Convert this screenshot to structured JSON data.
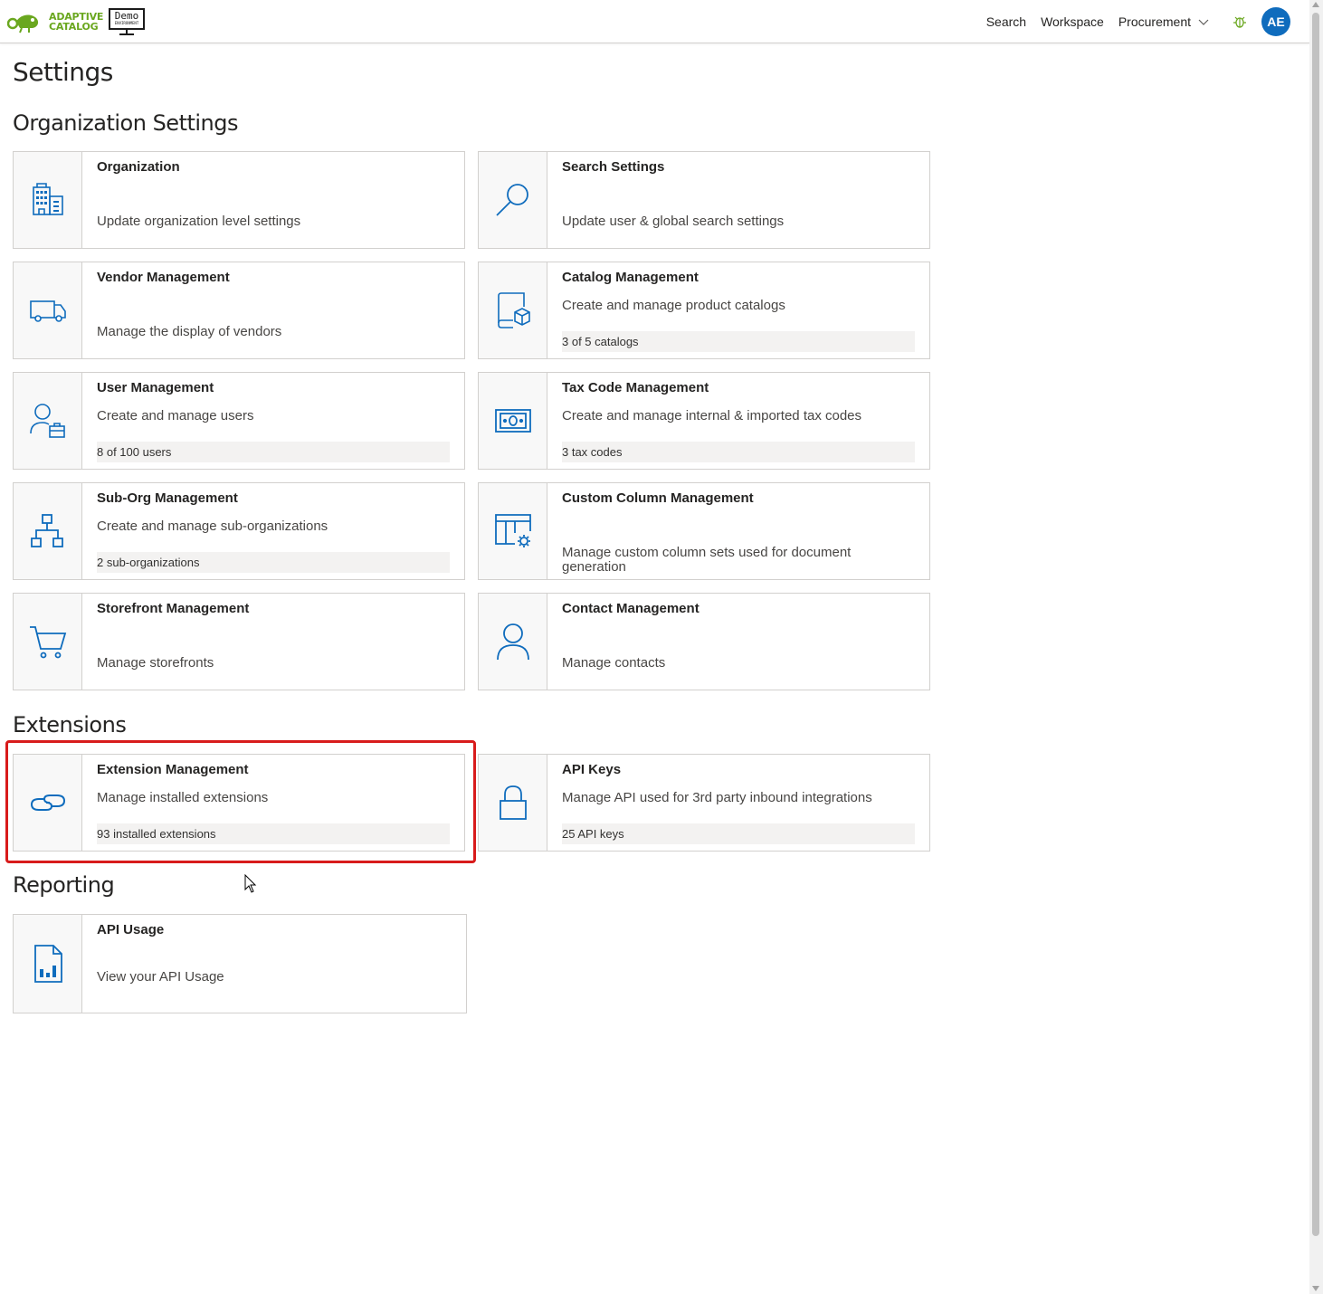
{
  "header": {
    "logo_line1": "ADAPTIVE",
    "logo_line2": "CATALOG",
    "demo_label": "Demo",
    "demo_sublabel": "ENVIRONMENT",
    "nav": {
      "search": "Search",
      "workspace": "Workspace",
      "procurement": "Procurement"
    },
    "avatar_initials": "AE",
    "accent_color": "#0f6cbd",
    "brand_color": "#6aa71f"
  },
  "page": {
    "title": "Settings"
  },
  "sections": {
    "org": "Organization Settings",
    "extensions": "Extensions",
    "reporting": "Reporting"
  },
  "cards": {
    "organization": {
      "title": "Organization",
      "desc": "Update organization level settings",
      "icon": "building-icon"
    },
    "search_settings": {
      "title": "Search Settings",
      "desc": "Update user & global search settings",
      "icon": "search-icon"
    },
    "vendor": {
      "title": "Vendor Management",
      "desc": "Manage the display of vendors",
      "icon": "truck-icon"
    },
    "catalog": {
      "title": "Catalog Management",
      "desc": "Create and manage product catalogs",
      "count": "3 of 5 catalogs",
      "icon": "catalog-box-icon"
    },
    "user": {
      "title": "User Management",
      "desc": "Create and manage users",
      "count": "8 of 100 users",
      "icon": "user-briefcase-icon"
    },
    "taxcode": {
      "title": "Tax Code Management",
      "desc": "Create and manage internal & imported tax codes",
      "count": "3 tax codes",
      "icon": "money-icon"
    },
    "suborg": {
      "title": "Sub-Org Management",
      "desc": "Create and manage sub-organizations",
      "count": "2 sub-organizations",
      "icon": "org-chart-icon"
    },
    "customcol": {
      "title": "Custom Column Management",
      "desc": "Manage custom column sets used for document generation",
      "icon": "table-settings-icon"
    },
    "storefront": {
      "title": "Storefront Management",
      "desc": "Manage storefronts",
      "icon": "cart-icon"
    },
    "contact": {
      "title": "Contact Management",
      "desc": "Manage contacts",
      "icon": "person-icon"
    },
    "extension": {
      "title": "Extension Management",
      "desc": "Manage installed extensions",
      "count": "93 installed extensions",
      "icon": "link-icon"
    },
    "apikeys": {
      "title": "API Keys",
      "desc": "Manage API used for 3rd party inbound integrations",
      "count": "25 API keys",
      "icon": "lock-icon"
    },
    "apiusage": {
      "title": "API Usage",
      "desc": "View your API Usage",
      "icon": "report-chart-icon"
    }
  }
}
